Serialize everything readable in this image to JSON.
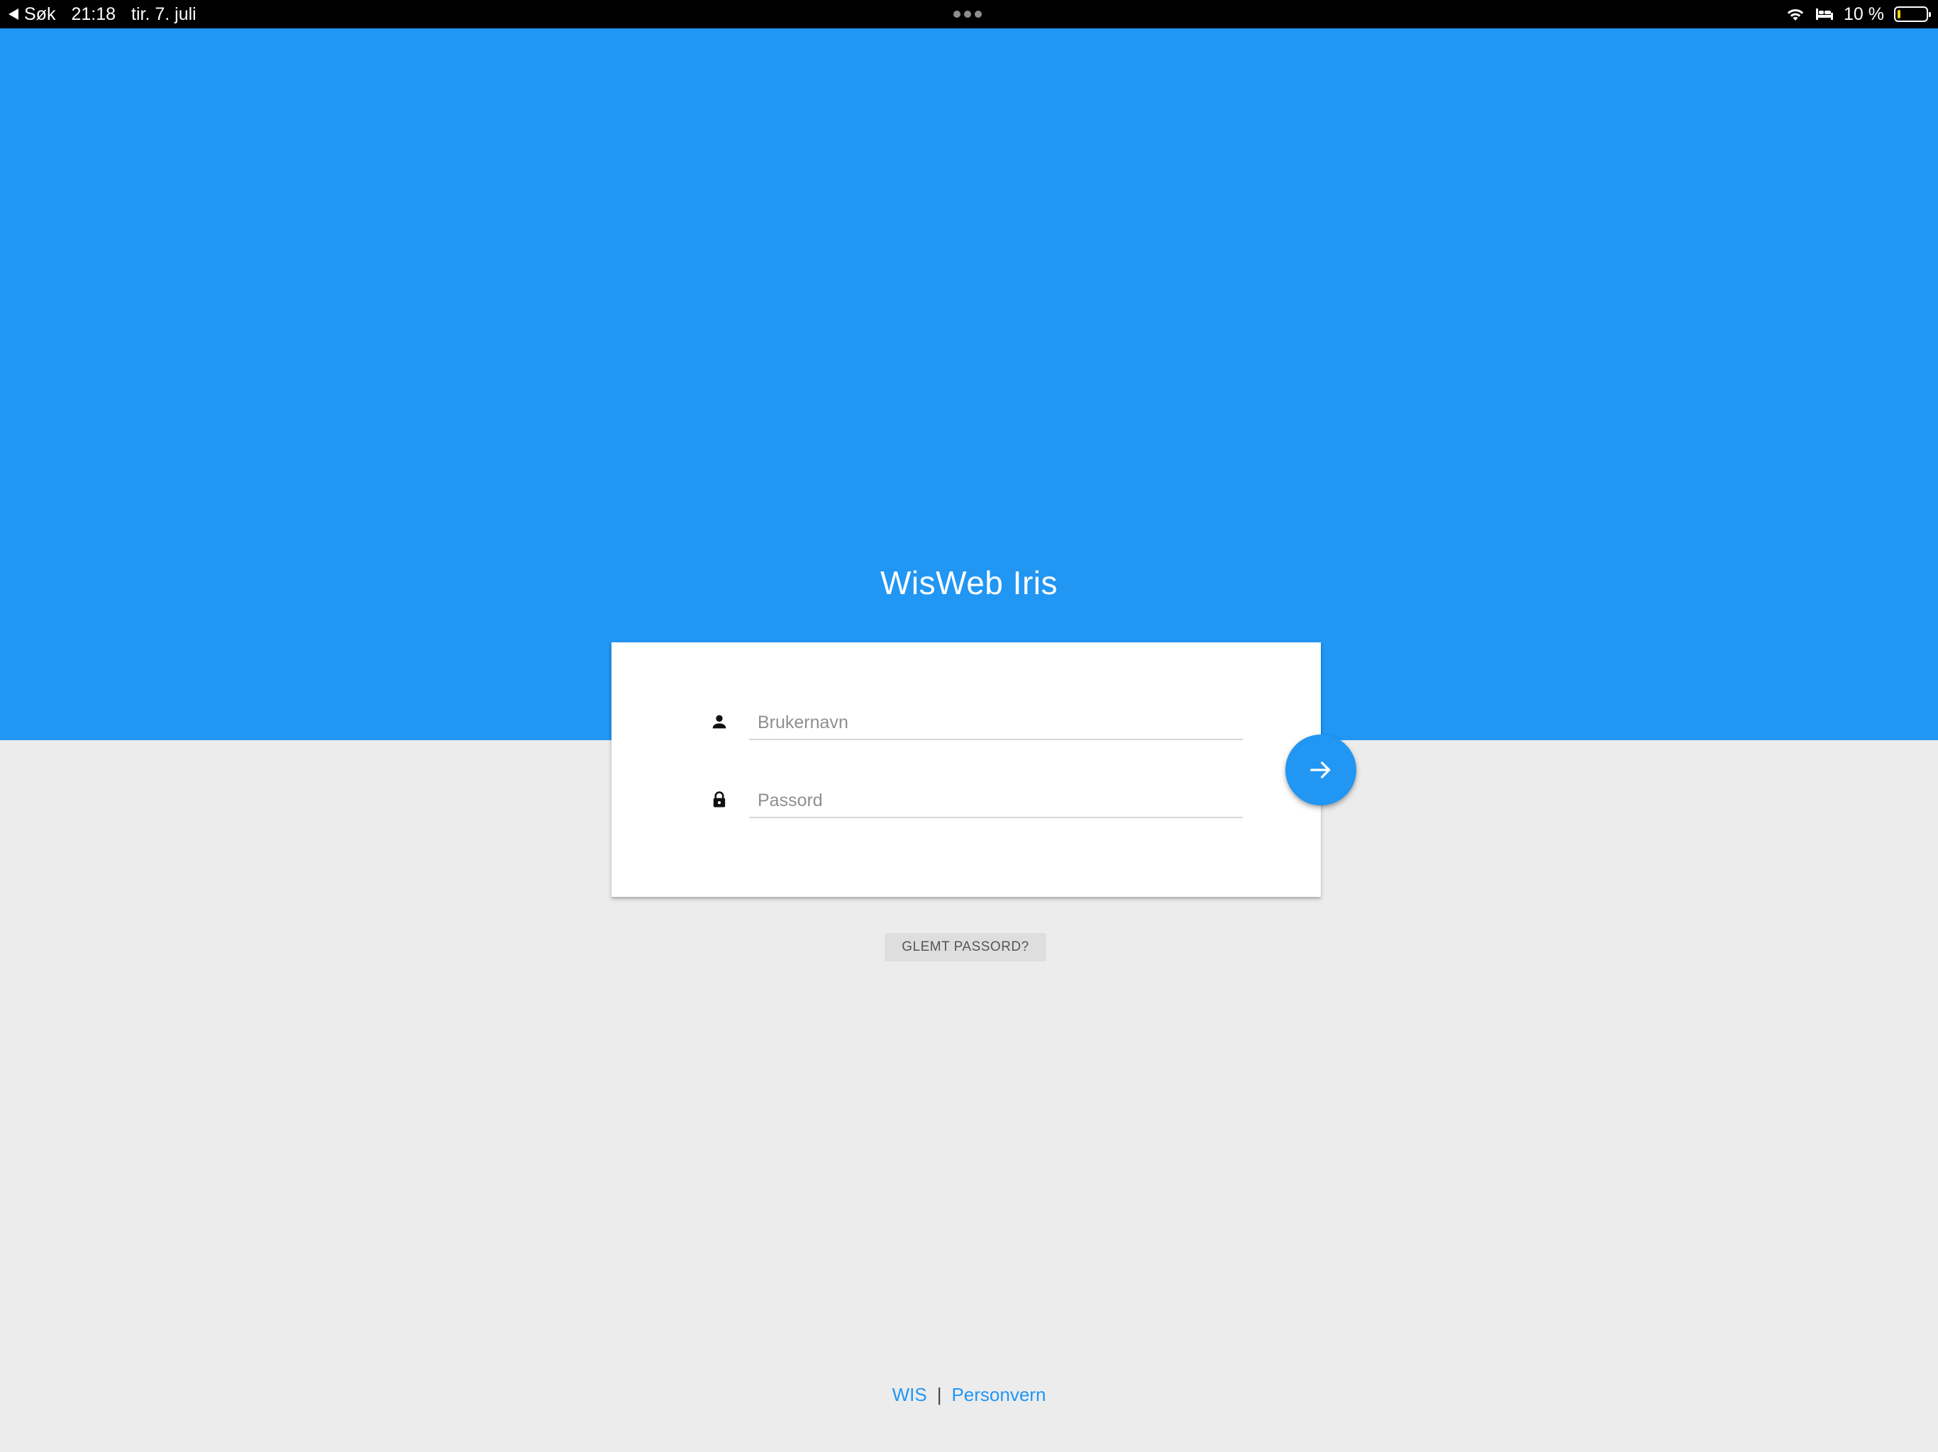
{
  "status_bar": {
    "back_label": "Søk",
    "time": "21:18",
    "date": "tir. 7. juli",
    "battery_text": "10 %",
    "battery_level_percent": 10,
    "icons": [
      "back-arrow-icon",
      "multitasking-dots-icon",
      "wifi-icon",
      "sleep-mode-bed-icon",
      "battery-icon"
    ]
  },
  "header": {
    "title": "WisWeb Iris",
    "background_color": "#2196f3"
  },
  "login": {
    "username": {
      "placeholder": "Brukernavn",
      "value": "",
      "icon": "person-icon"
    },
    "password": {
      "placeholder": "Passord",
      "value": "",
      "icon": "lock-icon"
    },
    "submit_icon": "arrow-right-icon",
    "forgot_password_label": "GLEMT PASSORD?"
  },
  "footer": {
    "links": [
      {
        "label": "WIS"
      },
      {
        "label": "Personvern"
      }
    ],
    "separator": "|",
    "link_color": "#2196f3"
  },
  "colors": {
    "accent": "#2196f3",
    "page_background": "#ececec",
    "card_background": "#ffffff"
  }
}
